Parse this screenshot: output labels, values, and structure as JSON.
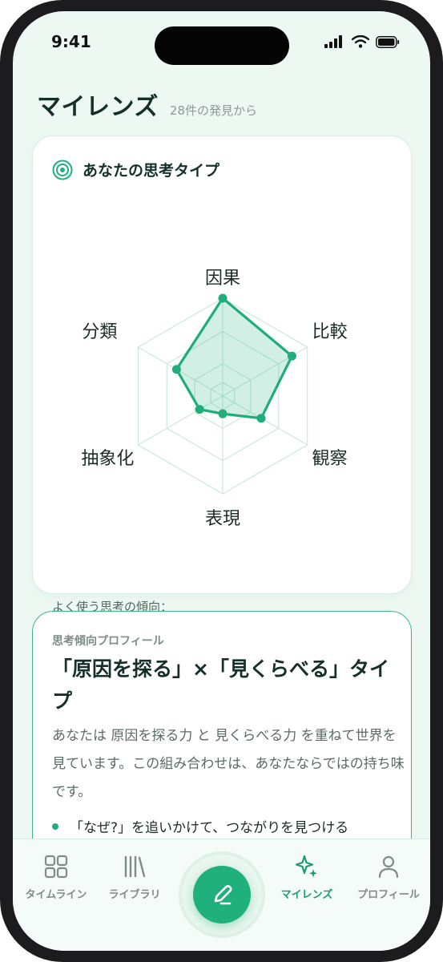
{
  "status": {
    "time": "9:41"
  },
  "header": {
    "title": "マイレンズ",
    "subtitle": "28件の発見から"
  },
  "radar_card": {
    "title": "あなたの思考タイプ",
    "tendency_label": "よく使う思考の傾向：",
    "chips": [
      {
        "name": "因果",
        "count": "11",
        "highlight": true
      },
      {
        "name": "比較",
        "count": "9",
        "highlight": true
      },
      {
        "name": "分類",
        "count": "6",
        "highlight": false
      },
      {
        "name": "観察",
        "count": "5",
        "highlight": false
      },
      {
        "name": "抽象化",
        "count": "3",
        "highlight": false
      },
      {
        "name": "表現",
        "count": "2",
        "highlight": false
      }
    ]
  },
  "chart_data": {
    "type": "radar",
    "categories": [
      "因果",
      "比較",
      "観察",
      "表現",
      "抽象化",
      "分類"
    ],
    "values": [
      11,
      9,
      5,
      2,
      3,
      6
    ],
    "max": 11
  },
  "profile_card": {
    "eyebrow": "思考傾向プロフィール",
    "title": "「原因を探る」×「見くらべる」タイプ",
    "body": "あなたは 原因を探る力 と 見くらべる力 を重ねて世界を見ています。この組み合わせは、あなたならではの持ち味です。",
    "bullet": "「なぜ?」を追いかけて、つながりを見つける"
  },
  "tabs": [
    {
      "label": "タイムライン",
      "icon": "grid-icon"
    },
    {
      "label": "ライブラリ",
      "icon": "library-icon"
    },
    {
      "label": "マイレンズ",
      "icon": "sparkle-icon"
    },
    {
      "label": "プロフィール",
      "icon": "person-icon"
    }
  ],
  "colors": {
    "accent": "#1fb07e",
    "accent_text": "#1d9c6d",
    "background": "#eef8f3"
  }
}
